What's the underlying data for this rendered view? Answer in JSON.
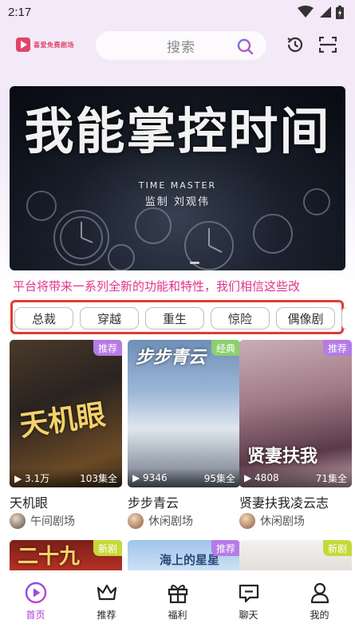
{
  "status": {
    "time": "2:17"
  },
  "header": {
    "logo_text": "喜爱免费剧场",
    "search_placeholder": "搜索"
  },
  "banner": {
    "title": "我能掌控时间",
    "subtitle_en": "TIME MASTER",
    "credit": "监制 刘观伟"
  },
  "marquee": "平台将带来一系列全新的功能和特性，我们相信这些改",
  "tags": [
    "总裁",
    "穿越",
    "重生",
    "惊险",
    "偶像剧"
  ],
  "dramas": [
    {
      "title": "天机眼",
      "badge": "推荐",
      "badge_color": "#b57be6",
      "plays": "3.1万",
      "episodes": "103集全",
      "channel": "午间剧场",
      "poster_text": "天机眼"
    },
    {
      "title": "步步青云",
      "badge": "经典",
      "badge_color": "#8ccf6e",
      "plays": "9346",
      "episodes": "95集全",
      "channel": "休闲剧场",
      "poster_text": "步步青云"
    },
    {
      "title": "贤妻扶我凌云志",
      "badge": "推荐",
      "badge_color": "#b57be6",
      "plays": "4808",
      "episodes": "71集全",
      "channel": "休闲剧场",
      "poster_text": "贤妻扶我"
    }
  ],
  "dramas_row2": [
    {
      "badge": "新剧",
      "badge_color": "#c6d93a",
      "poster_text": "二十九"
    },
    {
      "badge": "推荐",
      "badge_color": "#b57be6",
      "poster_text": "海上的星星"
    },
    {
      "badge": "新剧",
      "badge_color": "#c6d93a"
    }
  ],
  "tabbar": [
    {
      "label": "首页",
      "icon": "play-circle-icon",
      "active": true
    },
    {
      "label": "推荐",
      "icon": "crown-icon",
      "active": false
    },
    {
      "label": "福利",
      "icon": "gift-icon",
      "active": false
    },
    {
      "label": "聊天",
      "icon": "chat-icon",
      "active": false
    },
    {
      "label": "我的",
      "icon": "user-icon",
      "active": false
    }
  ],
  "colors": {
    "accent": "#b03bd8",
    "marquee": "#e0338c",
    "highlight_frame": "#e03c32"
  }
}
